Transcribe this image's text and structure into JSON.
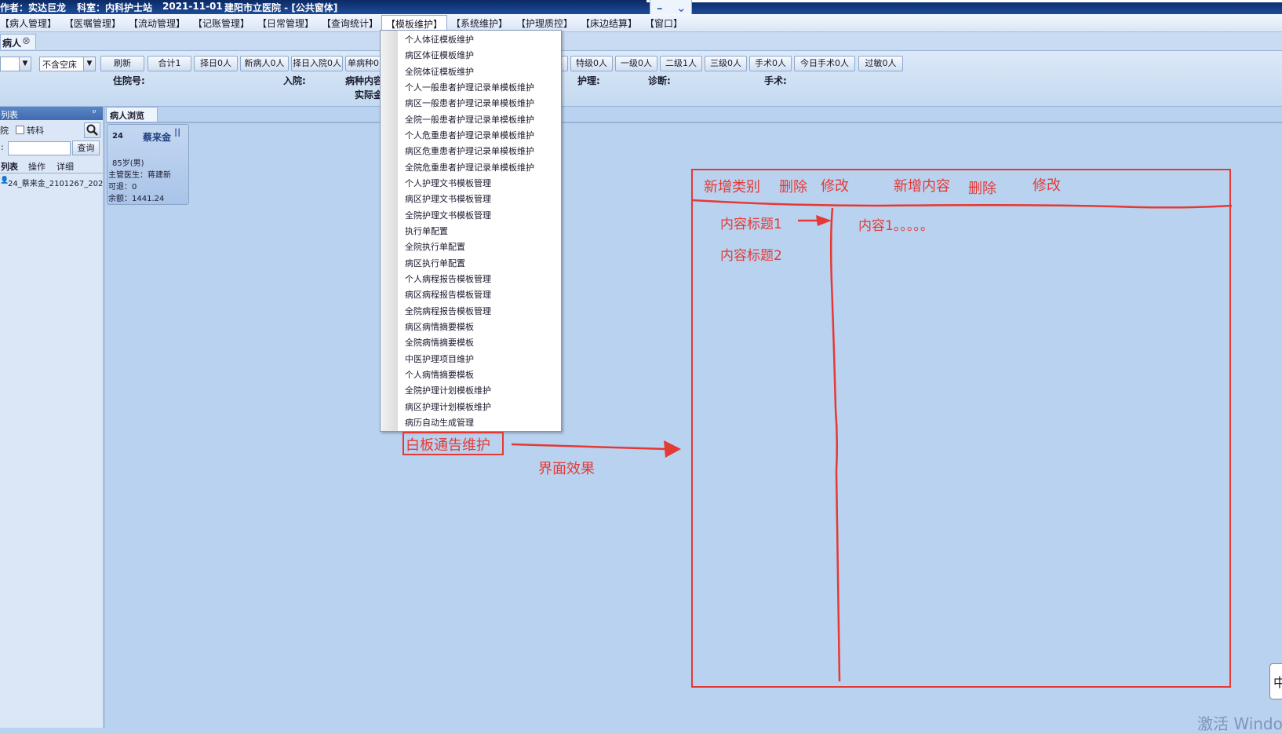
{
  "titlebar": {
    "operator": "作者：实达巨龙",
    "dept": "科室：内科护士站",
    "date": "2021-11-01",
    "hospital": "建阳市立医院 - [公共窗体]"
  },
  "window_controls": {
    "minimize": "–",
    "dropdown": "⌄"
  },
  "menu": [
    "【病人管理】",
    "【医嘱管理】",
    "【流动管理】",
    "【记账管理】",
    "【日常管理】",
    "【查询统计】",
    "【模板维护】",
    "【系统维护】",
    "【护理质控】",
    "【床边结算】",
    "【窗口】"
  ],
  "open_tab": {
    "label": "病人",
    "close": "⊗"
  },
  "toolbar": {
    "combo1": "",
    "combo2": "不含空床",
    "buttons": [
      "刷新",
      "合计1",
      "择日0人",
      "新病人0人",
      "择日入院0人",
      "单病种0"
    ],
    "buttons_right": [
      "特级0人",
      "一级0人",
      "二级1人",
      "三级0人",
      "手术0人",
      "今日手术0人",
      "过敏0人"
    ],
    "fields": {
      "inpatient_no": "住院号:",
      "admission": "入院:",
      "disease_type": "病种内容",
      "actual": "实际金",
      "nursing": "护理:",
      "diagnosis": "诊断:",
      "surgery": "手术:"
    }
  },
  "left_panel": {
    "header": "列表",
    "pin": "ᵖ",
    "filter_left": "院",
    "filter_transfer": "转科",
    "search_label": ":",
    "search_value": "",
    "query_button": "查询",
    "tabs": [
      "列表",
      "操作",
      "详细"
    ],
    "patient_item": "24_蔡来金_2101267_202"
  },
  "browse_tab": "病人浏览",
  "patient_card": {
    "bed": "24",
    "name": "蔡来金",
    "level_mark": "II",
    "age": "85岁(男)",
    "doctor": "主管医生：蒋建新",
    "refund": "可退：0",
    "balance": "余额：1441.24"
  },
  "template_menu": [
    "个人体征模板维护",
    "病区体征模板维护",
    "全院体征模板维护",
    "个人一般患者护理记录单模板维护",
    "病区一般患者护理记录单模板维护",
    "全院一般患者护理记录单模板维护",
    "个人危重患者护理记录单模板维护",
    "病区危重患者护理记录单模板维护",
    "全院危重患者护理记录单模板维护",
    "个人护理文书模板管理",
    "病区护理文书模板管理",
    "全院护理文书模板管理",
    "执行单配置",
    "全院执行单配置",
    "病区执行单配置",
    "个人病程报告模板管理",
    "病区病程报告模板管理",
    "全院病程报告模板管理",
    "病区病情摘要模板",
    "全院病情摘要模板",
    "中医护理项目维护",
    "个人病情摘要模板",
    "全院护理计划模板维护",
    "病区护理计划模板维护",
    "病历自动生成管理"
  ],
  "annotations": {
    "new_item": "白板通告维护",
    "arrow_caption": "界面效果",
    "mock_toolbar": [
      "新增类别",
      "删除",
      "修改",
      "新增内容",
      "删除",
      "修改"
    ],
    "content_titles": [
      "内容标题1",
      "内容标题2"
    ],
    "content_text": "内容1。。。。。"
  },
  "watermark": "激活 Windo",
  "ime": "中",
  "colors": {
    "annotation_red": "#e53935",
    "title_blue": "#0b2a66",
    "workspace": "#b9d2ef"
  }
}
